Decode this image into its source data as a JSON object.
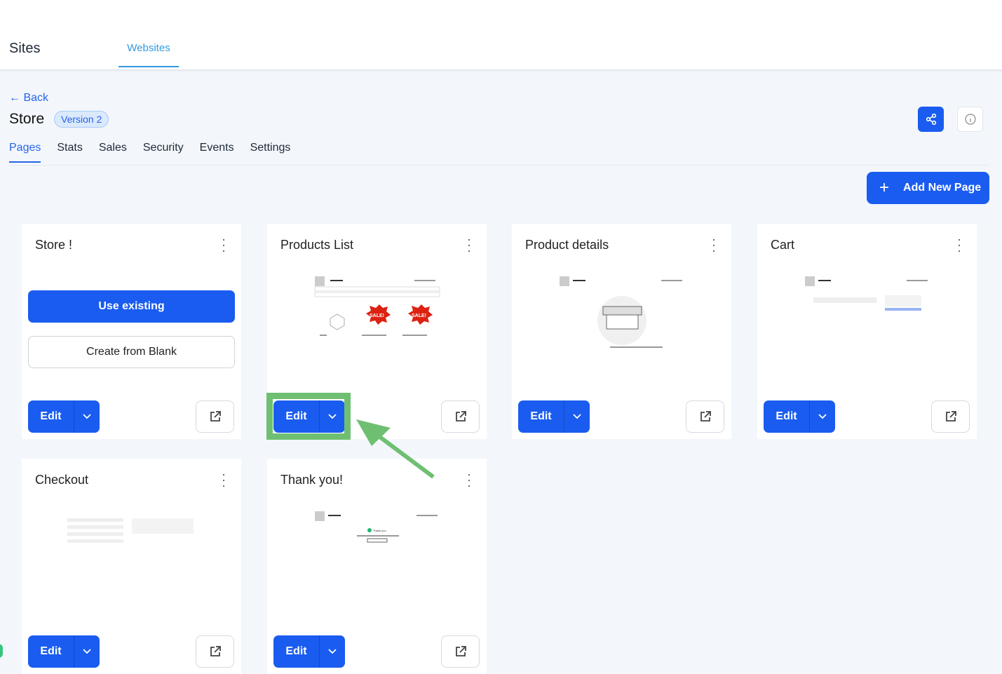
{
  "header": {
    "title": "Sites",
    "tab": "Websites"
  },
  "page": {
    "back": "Back",
    "title": "Store",
    "version": "Version 2",
    "tabs": [
      "Pages",
      "Stats",
      "Sales",
      "Security",
      "Events",
      "Settings"
    ],
    "active_tab": "Pages",
    "add_button": "Add New Page"
  },
  "cards": [
    {
      "name": "Store !",
      "use_existing": "Use existing",
      "create_blank": "Create from Blank",
      "edit": "Edit"
    },
    {
      "name": "Products List",
      "edit": "Edit"
    },
    {
      "name": "Product details",
      "edit": "Edit"
    },
    {
      "name": "Cart",
      "edit": "Edit"
    },
    {
      "name": "Checkout",
      "edit": "Edit"
    },
    {
      "name": "Thank you!",
      "edit": "Edit"
    }
  ],
  "thumbs": {
    "sale": "SALE!",
    "thank": "Thank you"
  },
  "colors": {
    "primary": "#1a5cf0",
    "highlight": "#6fbf73",
    "websites_tab": "#2f9be0"
  }
}
